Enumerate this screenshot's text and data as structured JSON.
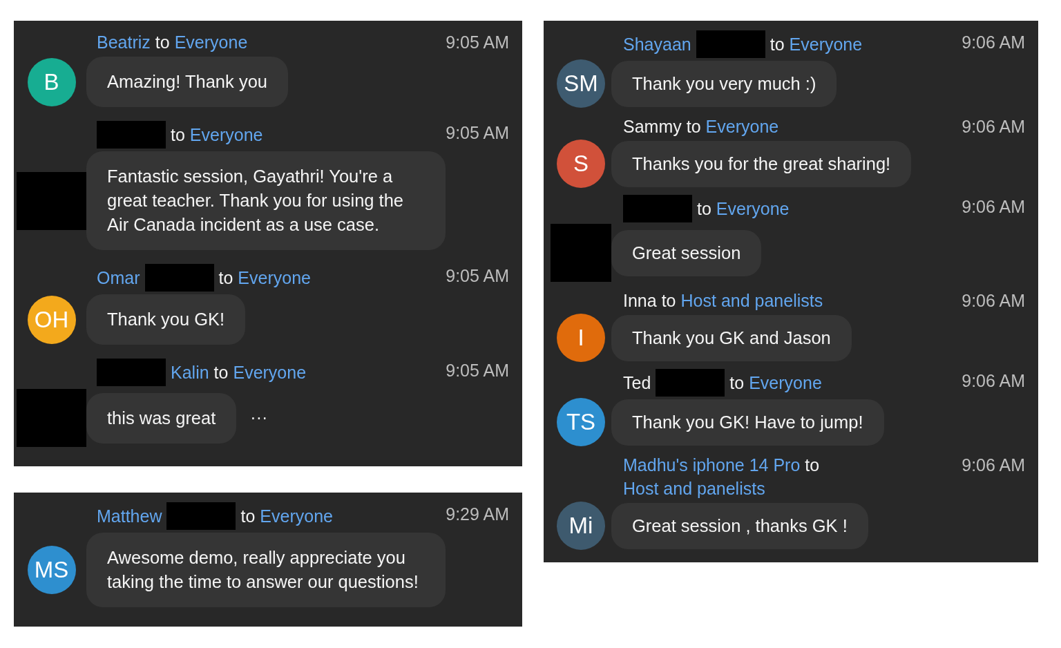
{
  "panels": [
    {
      "messages": [
        {
          "sender": [
            {
              "kind": "sender",
              "text": "Beatriz",
              "linked": true
            },
            {
              "kind": "to",
              "text": "to",
              "linked": false
            },
            {
              "kind": "recipient",
              "text": "Everyone",
              "linked": true
            }
          ],
          "time": "9:05 AM",
          "avatar": {
            "kind": "initials",
            "initials": "B",
            "color": "#17ad92"
          },
          "text": "Amazing! Thank you"
        },
        {
          "sender": [
            {
              "kind": "redacted"
            },
            {
              "kind": "to",
              "text": "to",
              "linked": false
            },
            {
              "kind": "recipient",
              "text": "Everyone",
              "linked": true
            }
          ],
          "time": "9:05 AM",
          "avatar": {
            "kind": "redacted"
          },
          "text": "Fantastic session, Gayathri! You're a great teacher. Thank you for using the Air Canada incident as a use case."
        },
        {
          "sender": [
            {
              "kind": "sender",
              "text": "Omar",
              "linked": true
            },
            {
              "kind": "redacted"
            },
            {
              "kind": "to",
              "text": "to",
              "linked": false
            },
            {
              "kind": "recipient",
              "text": "Everyone",
              "linked": true
            }
          ],
          "time": "9:05 AM",
          "avatar": {
            "kind": "initials",
            "initials": "OH",
            "color": "#f3a91c"
          },
          "text": "Thank you GK!"
        },
        {
          "sender": [
            {
              "kind": "redacted"
            },
            {
              "kind": "sender",
              "text": "Kalin",
              "linked": true
            },
            {
              "kind": "to",
              "text": "to",
              "linked": false
            },
            {
              "kind": "recipient",
              "text": "Everyone",
              "linked": true
            }
          ],
          "time": "9:05 AM",
          "avatar": {
            "kind": "redacted"
          },
          "text": "this was great",
          "trailing": "···"
        }
      ]
    },
    {
      "messages": [
        {
          "sender": [
            {
              "kind": "sender",
              "text": "Matthew",
              "linked": true
            },
            {
              "kind": "redacted"
            },
            {
              "kind": "to",
              "text": "to",
              "linked": false
            },
            {
              "kind": "recipient",
              "text": "Everyone",
              "linked": true
            }
          ],
          "time": "9:29 AM",
          "avatar": {
            "kind": "initials",
            "initials": "MS",
            "color": "#2e8fcf"
          },
          "text": "Awesome demo, really appreciate you taking the time to answer our questions!"
        }
      ]
    },
    {
      "messages": [
        {
          "sender": [
            {
              "kind": "sender",
              "text": "Shayaan",
              "linked": true
            },
            {
              "kind": "redacted"
            },
            {
              "kind": "to",
              "text": "to",
              "linked": false
            },
            {
              "kind": "recipient",
              "text": "Everyone",
              "linked": true
            }
          ],
          "time": "9:06 AM",
          "avatar": {
            "kind": "initials",
            "initials": "SM",
            "color": "#3e5b70"
          },
          "text": "Thank you very much :)"
        },
        {
          "sender": [
            {
              "kind": "sender",
              "text": "Sammy",
              "linked": false
            },
            {
              "kind": "to",
              "text": "to",
              "linked": false
            },
            {
              "kind": "recipient",
              "text": "Everyone",
              "linked": true
            }
          ],
          "time": "9:06 AM",
          "avatar": {
            "kind": "initials",
            "initials": "S",
            "color": "#d1513a"
          },
          "text": "Thanks you for the great sharing!"
        },
        {
          "sender": [
            {
              "kind": "redacted"
            },
            {
              "kind": "to",
              "text": "to",
              "linked": false
            },
            {
              "kind": "recipient",
              "text": "Everyone",
              "linked": true
            }
          ],
          "time": "9:06 AM",
          "avatar": {
            "kind": "redacted"
          },
          "text": "Great session"
        },
        {
          "sender": [
            {
              "kind": "sender",
              "text": "Inna",
              "linked": false
            },
            {
              "kind": "to",
              "text": "to",
              "linked": false
            },
            {
              "kind": "recipient",
              "text": "Host and panelists",
              "linked": true
            }
          ],
          "time": "9:06 AM",
          "avatar": {
            "kind": "initials",
            "initials": "I",
            "color": "#e06b0c"
          },
          "text": "Thank you GK and Jason"
        },
        {
          "sender": [
            {
              "kind": "sender",
              "text": "Ted",
              "linked": false
            },
            {
              "kind": "redacted"
            },
            {
              "kind": "to",
              "text": "to",
              "linked": false
            },
            {
              "kind": "recipient",
              "text": "Everyone",
              "linked": true
            }
          ],
          "time": "9:06 AM",
          "avatar": {
            "kind": "initials",
            "initials": "TS",
            "color": "#2d8fcf"
          },
          "text": "Thank you GK! Have to jump!"
        },
        {
          "sender": [
            {
              "kind": "sender",
              "text": "Madhu's iphone 14 Pro",
              "linked": true
            },
            {
              "kind": "to",
              "text": "to",
              "linked": false
            },
            {
              "kind": "recipient",
              "text": "Host and panelists",
              "linked": true
            }
          ],
          "time": "9:06 AM",
          "avatar": {
            "kind": "initials",
            "initials": "Mi",
            "color": "#3e5a6e"
          },
          "text": "Great session , thanks GK !"
        }
      ]
    }
  ]
}
